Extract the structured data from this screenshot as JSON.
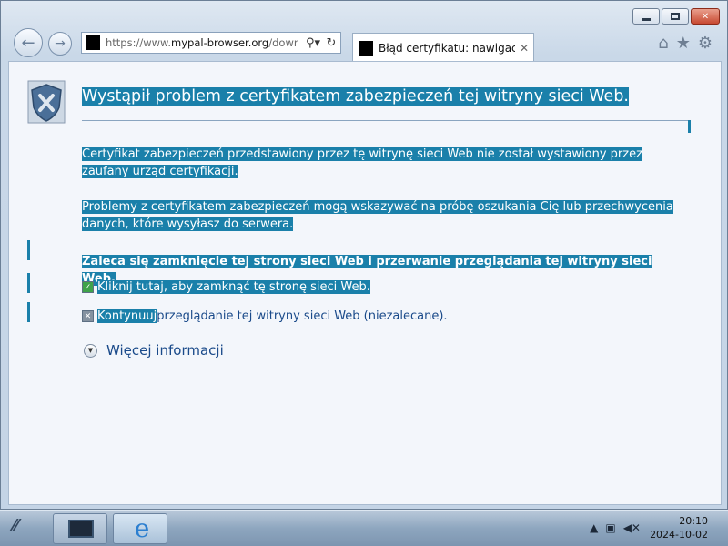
{
  "browser": {
    "address_url_plain_start": "https://www.",
    "address_url_domain": "mypal-browser.org",
    "address_url_rest": "/dowr",
    "search_icon": "search-icon",
    "refresh_icon": "refresh-icon",
    "tab_title": "Błąd certyfikatu: nawigacja ...",
    "tab_close": "✕",
    "toolbar_icons": [
      "home-icon",
      "favorites-star-icon",
      "settings-gear-icon"
    ]
  },
  "page": {
    "heading": "Wystąpił problem z certyfikatem zabezpieczeń tej witryny sieci Web.",
    "para1": "Certyfikat zabezpieczeń przedstawiony przez tę witrynę sieci Web nie został wystawiony przez zaufany urząd certyfikacji.",
    "para2": "Problemy z certyfikatem zabezpieczeń mogą wskazywać na próbę oszukania Cię lub przechwycenia danych, które wysyłasz do serwera.",
    "recommendation": "Zaleca się zamknięcie tej strony sieci Web i przerwanie przeglądania tej witryny sieci Web.",
    "close_link": "Kliknij tutaj, aby zamknąć tę stronę sieci Web.",
    "continue_link": "Kontynuuj",
    "continue_rest": " przeglądanie tej witryny sieci Web (niezalecane).",
    "more_info": "Więcej informacji"
  },
  "taskbar": {
    "clock_time": "20:10",
    "clock_date": "2024-10-02"
  },
  "colors": {
    "selection": "#1a80aa",
    "link": "#1a4a8a"
  }
}
